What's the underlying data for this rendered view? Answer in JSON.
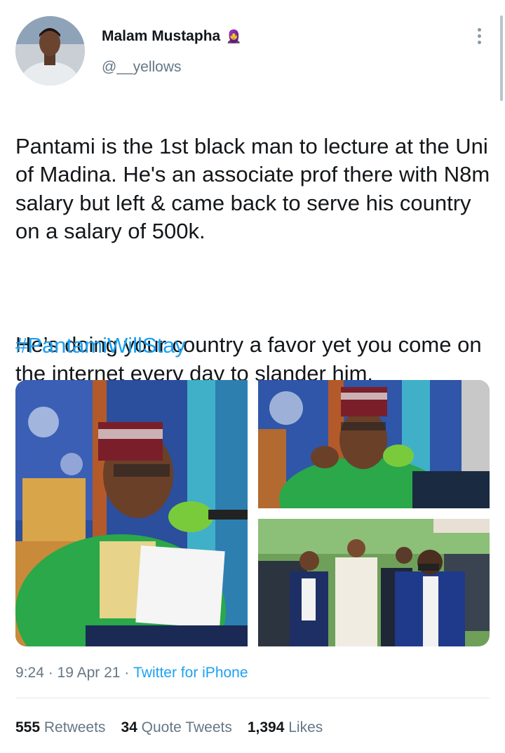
{
  "author": {
    "name": "Malam Mustapha",
    "name_emoji": "🧕",
    "handle": "@__yellows"
  },
  "tweet": {
    "paragraph1": "Pantami is the 1st black man to lecture at the Uni of Madina. He's an associate prof there with N8m salary but left & came back to serve his country on a salary of 500k.",
    "paragraph2": "He’s doing your country a favor yet you come on the internet every day to slander him.",
    "hashtag": "#PantamiWillStay"
  },
  "meta": {
    "time": "9:24",
    "separator1": " · ",
    "date": "19 Apr 21",
    "separator2": " · ",
    "source": "Twitter for iPhone"
  },
  "stats": {
    "retweets_count": "555",
    "retweets_label": "Retweets",
    "quotes_count": "34",
    "quotes_label": "Quote Tweets",
    "likes_count": "1,394",
    "likes_label": "Likes"
  },
  "colors": {
    "link": "#1da1f2",
    "secondary_text": "#657786",
    "primary_text": "#14171a"
  },
  "icons": {
    "more": "more-vertical-icon"
  }
}
